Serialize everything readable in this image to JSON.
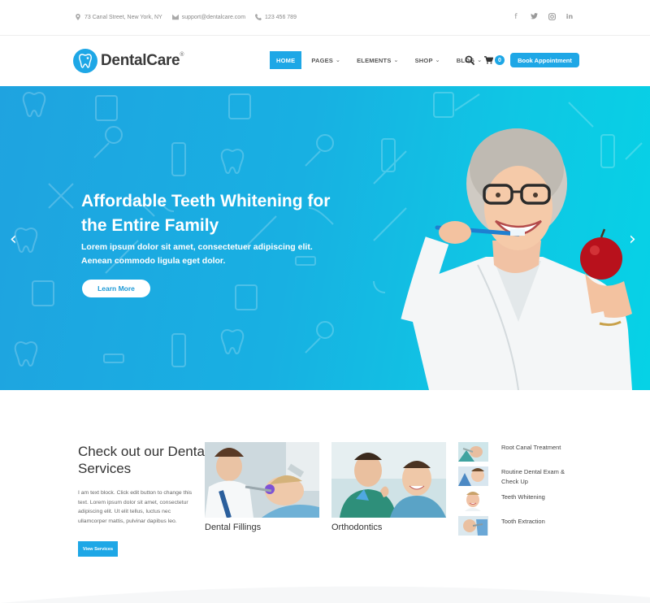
{
  "topbar": {
    "address": "73 Canal Street, New York, NY",
    "email": "support@dentalcare.com",
    "phone": "123 456 789",
    "social": [
      "f",
      "t",
      "ig",
      "in"
    ]
  },
  "header": {
    "logo_text": "DentalCare",
    "logo_reg": "®",
    "nav": [
      {
        "label": "HOME",
        "active": true
      },
      {
        "label": "PAGES",
        "dropdown": true
      },
      {
        "label": "ELEMENTS",
        "dropdown": true
      },
      {
        "label": "SHOP",
        "dropdown": true
      },
      {
        "label": "BLOG",
        "dropdown": true
      }
    ],
    "cart_count": "0",
    "book_label": "Book Appointment"
  },
  "hero": {
    "title": "Affordable Teeth Whitening for the Entire Family",
    "subtitle": "Lorem ipsum dolor sit amet, consectetuer adipiscing elit. Aenean commodo ligula eget dolor.",
    "cta": "Learn More",
    "prev_arrow": "‹",
    "next_arrow": "›"
  },
  "services": {
    "title": "Check out our Dental Services",
    "text": "I am text block. Click edit button to change this text. Lorem ipsum dolor sit amet, consectetur adipiscing elit. Ut elit tellus, luctus nec ullamcorper mattis, pulvinar dapibus leo.",
    "button": "View Services",
    "cards": [
      {
        "caption": "Dental Fillings"
      },
      {
        "caption": "Orthodontics"
      }
    ],
    "list": [
      {
        "label": "Root Canal Treatment"
      },
      {
        "label": "Routine Dental Exam & Check Up"
      },
      {
        "label": "Teeth Whitening"
      },
      {
        "label": "Tooth Extraction"
      }
    ]
  },
  "colors": {
    "accent": "#1ea7e6",
    "hero_start": "#1fa3e0",
    "hero_end": "#06d2e6"
  }
}
